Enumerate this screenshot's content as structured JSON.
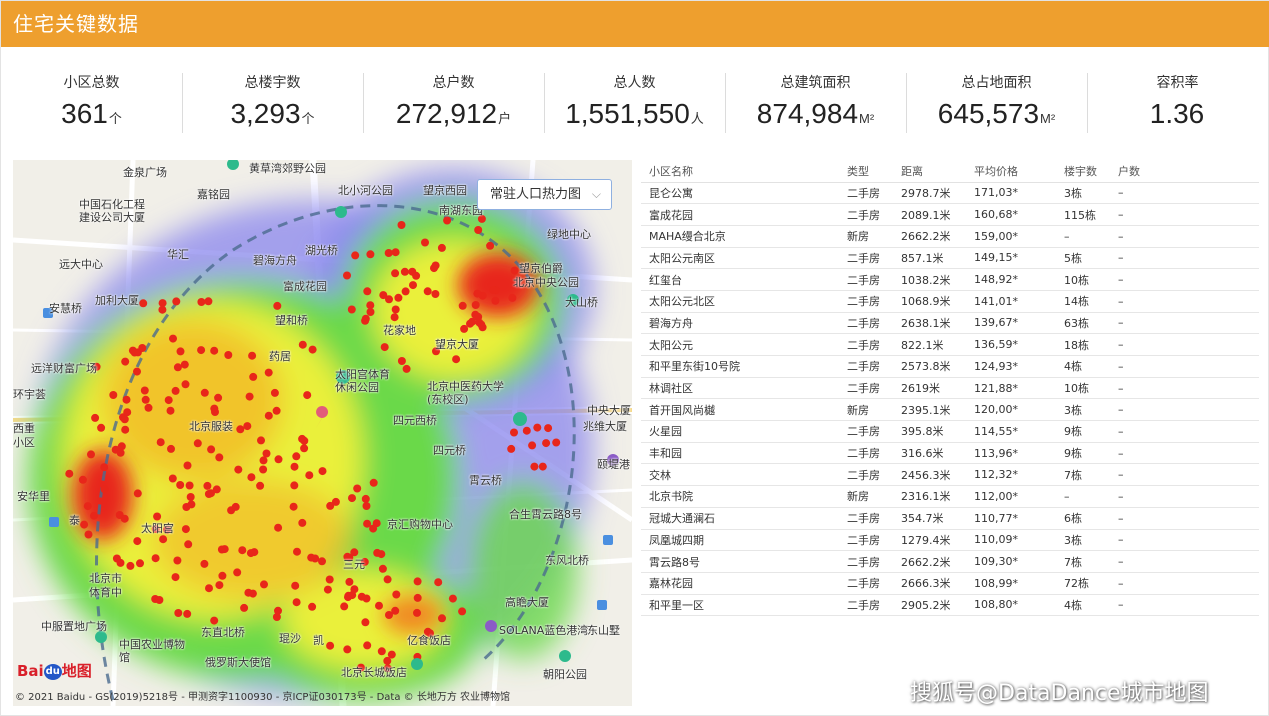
{
  "header": {
    "title": "住宅关键数据"
  },
  "stats": [
    {
      "label": "小区总数",
      "value": "361",
      "unit": "个"
    },
    {
      "label": "总楼宇数",
      "value": "3,293",
      "unit": "个"
    },
    {
      "label": "总户数",
      "value": "272,912",
      "unit": "户"
    },
    {
      "label": "总人数",
      "value": "1,551,550",
      "unit": "人"
    },
    {
      "label": "总建筑面积",
      "value": "874,984",
      "unit": "M²"
    },
    {
      "label": "总占地面积",
      "value": "645,573",
      "unit": "M²"
    },
    {
      "label": "容积率",
      "value": "1.36",
      "unit": ""
    }
  ],
  "map": {
    "layer_select": "常驻人口热力图",
    "logo_text": "Bai",
    "logo_paw": "du",
    "logo_suffix": "地图",
    "copyright": "© 2021 Baidu - GS(2019)5218号 - 甲测资字1100930 - 京ICP证030173号 - Data © 长地万方  农业博物馆",
    "labels": [
      "金泉广场",
      "黄草湾郊野公园",
      "中国石化工程建设公司大厦",
      "嘉铭园",
      "北小河公园",
      "望京西园",
      "望京伯爵",
      "南湖东园",
      "绿地中心",
      "远大中心",
      "华汇",
      "碧海方舟",
      "湖光桥",
      "富成花园",
      "北京中央公园",
      "加利大厦",
      "安慧桥",
      "大山桥",
      "望和桥",
      "花家地",
      "药居",
      "望京大厦",
      "太阳宫体育休闲公园",
      "北京中医药大学(东校区)",
      "远洋财富广场",
      "环宇荟",
      "四元西桥",
      "中央大厦",
      "北京服装",
      "四元桥",
      "兆维大厦",
      "西重",
      "小区",
      "颐堤港",
      "安华里",
      "霄云桥",
      "泰",
      "合生霄云路8号",
      "三元",
      "东风北桥",
      "北京市",
      "体育中",
      "高瞻大厦",
      "SOLANA蓝色港湾",
      "东山墅",
      "中服置地广场",
      "太阳宫",
      "京汇购物中心",
      "凯",
      "亿食饭店",
      "北京长城饭店",
      "中国农业博物馆",
      "俄罗斯大使馆",
      "朝阳公园",
      "东直北桥",
      "琨沙"
    ]
  },
  "table": {
    "headers": [
      "小区名称",
      "类型",
      "距离",
      "平均价格",
      "楼宇数",
      "户数"
    ],
    "rows": [
      [
        "昆仑公寓",
        "二手房",
        "2978.7米",
        "171,03*",
        "3栋",
        "–"
      ],
      [
        "富成花园",
        "二手房",
        "2089.1米",
        "160,68*",
        "115栋",
        "–"
      ],
      [
        "MAHA缦合北京",
        "新房",
        "2662.2米",
        "159,00*",
        "–",
        "–"
      ],
      [
        "太阳公元南区",
        "二手房",
        "857.1米",
        "149,15*",
        "5栋",
        "–"
      ],
      [
        "红玺台",
        "二手房",
        "1038.2米",
        "148,92*",
        "10栋",
        "–"
      ],
      [
        "太阳公元北区",
        "二手房",
        "1068.9米",
        "141,01*",
        "14栋",
        "–"
      ],
      [
        "碧海方舟",
        "二手房",
        "2638.1米",
        "139,67*",
        "63栋",
        "–"
      ],
      [
        "太阳公元",
        "二手房",
        "822.1米",
        "136,59*",
        "18栋",
        "–"
      ],
      [
        "和平里东街10号院",
        "二手房",
        "2573.8米",
        "124,93*",
        "4栋",
        "–"
      ],
      [
        "林调社区",
        "二手房",
        "2619米",
        "121,88*",
        "10栋",
        "–"
      ],
      [
        "首开国风尚樾",
        "新房",
        "2395.1米",
        "120,00*",
        "3栋",
        "–"
      ],
      [
        "火星园",
        "二手房",
        "395.8米",
        "114,55*",
        "9栋",
        "–"
      ],
      [
        "丰和园",
        "二手房",
        "316.6米",
        "113,96*",
        "9栋",
        "–"
      ],
      [
        "交林",
        "二手房",
        "2456.3米",
        "112,32*",
        "7栋",
        "–"
      ],
      [
        "北京书院",
        "新房",
        "2316.1米",
        "112,00*",
        "–",
        "–"
      ],
      [
        "冠城大通澜石",
        "二手房",
        "354.7米",
        "110,77*",
        "6栋",
        "–"
      ],
      [
        "凤凰城四期",
        "二手房",
        "1279.4米",
        "110,09*",
        "3栋",
        "–"
      ],
      [
        "霄云路8号",
        "二手房",
        "2662.2米",
        "109,30*",
        "7栋",
        "–"
      ],
      [
        "嘉林花园",
        "二手房",
        "2666.3米",
        "108,99*",
        "72栋",
        "–"
      ],
      [
        "和平里一区",
        "二手房",
        "2905.2米",
        "108,80*",
        "4栋",
        "–"
      ]
    ]
  },
  "watermark": "搜狐号@DataDance城市地图",
  "colors": {
    "header": "#ee9f2e",
    "heat_hot": "#e8261a",
    "heat_mid": "#f5e832",
    "heat_low": "#6cdc4a",
    "heat_edge": "#7f7ff0",
    "dot": "#e8261a"
  }
}
